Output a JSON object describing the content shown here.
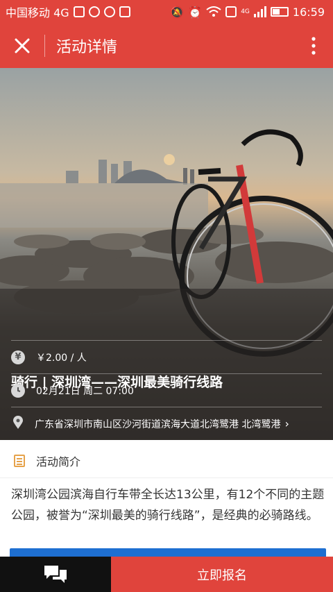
{
  "status_bar": {
    "carrier": "中国移动 4G",
    "network_badge": "4G",
    "time": "16:59",
    "icons": [
      "image-icon",
      "app-icon",
      "app-icon",
      "sim-icon",
      "mute-icon",
      "alarm-icon",
      "wifi-icon",
      "vibrate-icon",
      "signal-icon",
      "battery-icon"
    ]
  },
  "header": {
    "close_icon": "close-icon",
    "title": "活动详情",
    "more_icon": "more-vertical-icon"
  },
  "event": {
    "title": "骑行 | 深圳湾——深圳最美骑行线路",
    "price": "￥2.00 / 人",
    "datetime": "02月21日 周二 07:00",
    "location": "广东省深圳市南山区沙河街道滨海大道北湾鹭港 北湾鹭港",
    "price_icon": "yen-icon",
    "time_icon": "clock-icon",
    "location_icon": "pin-icon"
  },
  "intro": {
    "label": "活动简介",
    "text": "深圳湾公园滨海自行车带全长达13公里，有12个不同的主题公园，被誉为“深圳最美的骑行线路”，是经典的必骑路线。"
  },
  "bottom_bar": {
    "chat_icon": "chat-icon",
    "signup_label": "立即报名"
  },
  "colors": {
    "accent": "#e0443c",
    "bottom_dark": "#111111",
    "link_blue": "#1e6fd1"
  }
}
